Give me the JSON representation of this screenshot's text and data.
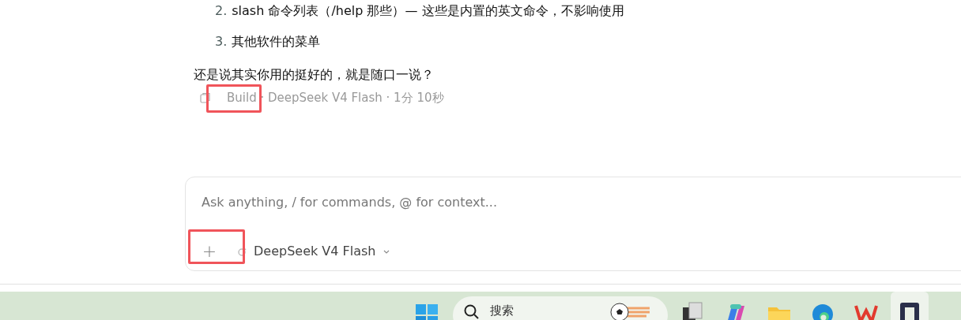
{
  "message": {
    "list": [
      {
        "number": "2.",
        "text": "slash 命令列表（/help 那些）— 这些是内置的英文命令，不影响使用"
      },
      {
        "number": "3.",
        "text": "其他软件的菜单"
      }
    ],
    "paragraph": "还是说其实你用的挺好的，就是随口一说？",
    "meta": "Build · DeepSeek V4 Flash · 1分 10秒"
  },
  "composer": {
    "placeholder": "Ask anything, / for commands, @ for context...",
    "add_label": "+",
    "model": "DeepSeek V4 Flash"
  },
  "taskbar": {
    "search": {
      "placeholder": "搜索"
    },
    "apps": [
      {
        "kind": "blocks",
        "selected": false
      },
      {
        "kind": "copilot",
        "selected": false
      },
      {
        "kind": "folder",
        "selected": false
      },
      {
        "kind": "edge",
        "selected": false
      },
      {
        "kind": "wps",
        "selected": false
      },
      {
        "kind": "terminal",
        "selected": true
      }
    ]
  }
}
